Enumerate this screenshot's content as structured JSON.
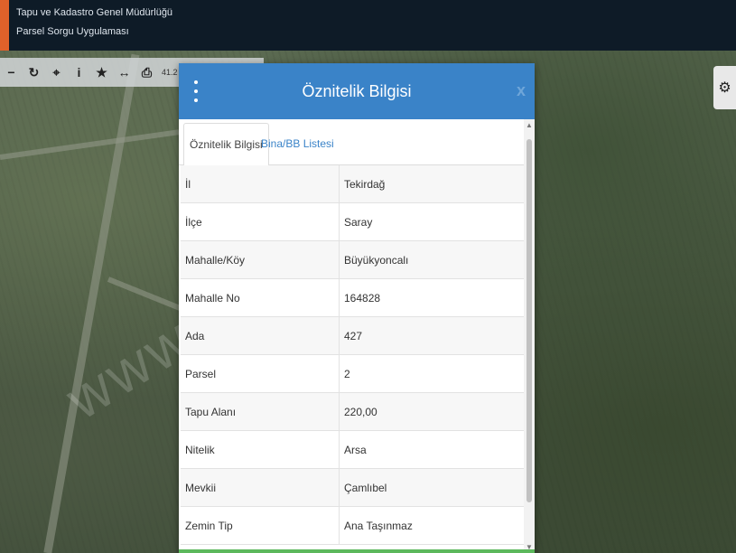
{
  "header": {
    "line1": "Tapu ve Kadastro Genel Müdürlüğü",
    "line2": "Parsel Sorgu Uygulaması",
    "accent_color": "#e0612a",
    "bg_color": "#0e1b27"
  },
  "toolbar": {
    "buttons": [
      {
        "icon": "minus-icon",
        "glyph": "−"
      },
      {
        "icon": "refresh-icon",
        "glyph": "↻"
      },
      {
        "icon": "locate-icon",
        "glyph": "⌖"
      },
      {
        "icon": "info-icon",
        "glyph": "i"
      },
      {
        "icon": "star-icon",
        "glyph": "★"
      },
      {
        "icon": "measure-icon",
        "glyph": "↔"
      },
      {
        "icon": "print-icon",
        "glyph": "⎙"
      }
    ],
    "coordinate": "41.2"
  },
  "settings": {
    "icon": "gear-icon",
    "glyph": "⚙"
  },
  "map": {
    "watermark": "www.          .net.tr"
  },
  "dialog": {
    "title": "Öznitelik Bilgisi",
    "close": "x",
    "header_color": "#3a83c8",
    "tabs": [
      {
        "label": "Öznitelik Bilgisi",
        "active": true
      },
      {
        "label": "Bina/BB Listesi",
        "active": false
      }
    ],
    "rows": [
      {
        "key": "İl",
        "value": "Tekirdağ"
      },
      {
        "key": "İlçe",
        "value": "Saray"
      },
      {
        "key": "Mahalle/Köy",
        "value": "Büyükyoncalı"
      },
      {
        "key": "Mahalle No",
        "value": "164828"
      },
      {
        "key": "Ada",
        "value": "427"
      },
      {
        "key": "Parsel",
        "value": "2"
      },
      {
        "key": "Tapu Alanı",
        "value": "220,00"
      },
      {
        "key": "Nitelik",
        "value": "Arsa"
      },
      {
        "key": "Mevkii",
        "value": "Çamlıbel"
      },
      {
        "key": "Zemin Tip",
        "value": "Ana Taşınmaz"
      }
    ]
  }
}
